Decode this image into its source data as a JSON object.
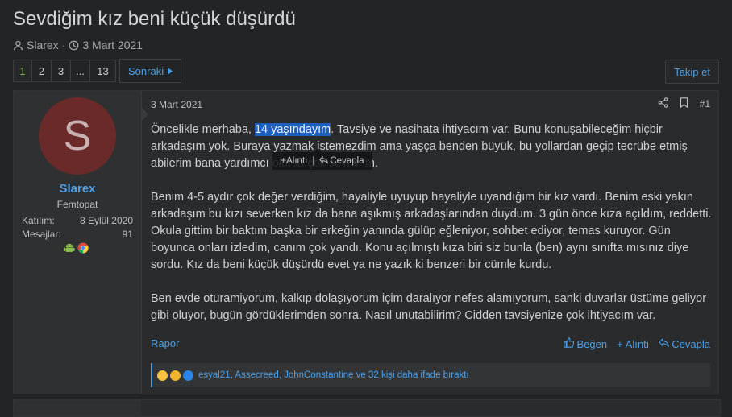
{
  "thread": {
    "title": "Sevdiğim kız beni küçük düşürdü",
    "author": "Slarex",
    "date": "3 Mart 2021"
  },
  "pagination": {
    "pages": [
      "1",
      "2",
      "3",
      "...",
      "13"
    ],
    "current": "1",
    "next_label": "Sonraki"
  },
  "follow_label": "Takip et",
  "post": {
    "date": "3 Mart 2021",
    "number": "#1",
    "user": {
      "initial": "S",
      "avatar_color": "#6b2a2a",
      "name": "Slarex",
      "title": "Femtopat",
      "joined_label": "Katılım:",
      "joined_value": "8 Eylül 2020",
      "messages_label": "Mesajlar:",
      "messages_value": "91"
    },
    "body": {
      "p1_before": "Öncelikle merhaba, ",
      "p1_highlight": "14 yaşındayım",
      "p1_after": ". Tavsiye ve nasihata ihtiyacım var. Bunu konuşabileceğim hiçbir arkadaşım yok. Buraya yazmak istemezdim ama yaşça benden büyük, bu yollardan geçip tecrübe etmiş abilerim bana yardımcı olursa çok sevinirim.",
      "p2": "Benim 4-5 aydır çok değer verdiğim, hayaliyle uyuyup hayaliyle uyandığım bir kız vardı. Benim eski yakın arkadaşım bu kızı severken kız da bana aşıkmış arkadaşlarından duydum. 3 gün önce kıza açıldım, reddetti. Okula gittim bir baktım başka bir erkeğin yanında gülüp eğleniyor, sohbet ediyor, temas kuruyor. Gün boyunca onları izledim, canım çok yandı. Konu açılmıştı kıza biri siz bunla (ben) aynı sınıfta mısınız diye sordu. Kız da beni küçük düşürdü evet ya ne yazık ki benzeri bir cümle kurdu.",
      "p3": "Ben evde oturamiyorum, kalkıp dolaşıyorum içim daralıyor nefes alamıyorum, sanki duvarlar üstüme geliyor gibi oluyor, bugün gördüklerimden sonra. Nasıl unutabilirim? Cidden tavsiyenize çok ihtiyacım var."
    },
    "selection_popup": {
      "quote_label": "Alıntı",
      "reply_label": "Cevapla"
    },
    "report_label": "Rapor",
    "like_label": "Beğen",
    "quote_label": "Alıntı",
    "reply_label": "Cevapla",
    "reactions_text": "esyal21, Assecreed, JohnConstantine ve 32 kişi daha ifade bıraktı"
  },
  "colors": {
    "accent": "#4fa0e6",
    "current_page": "#7fb24e",
    "highlight": "#1d5fbf"
  }
}
